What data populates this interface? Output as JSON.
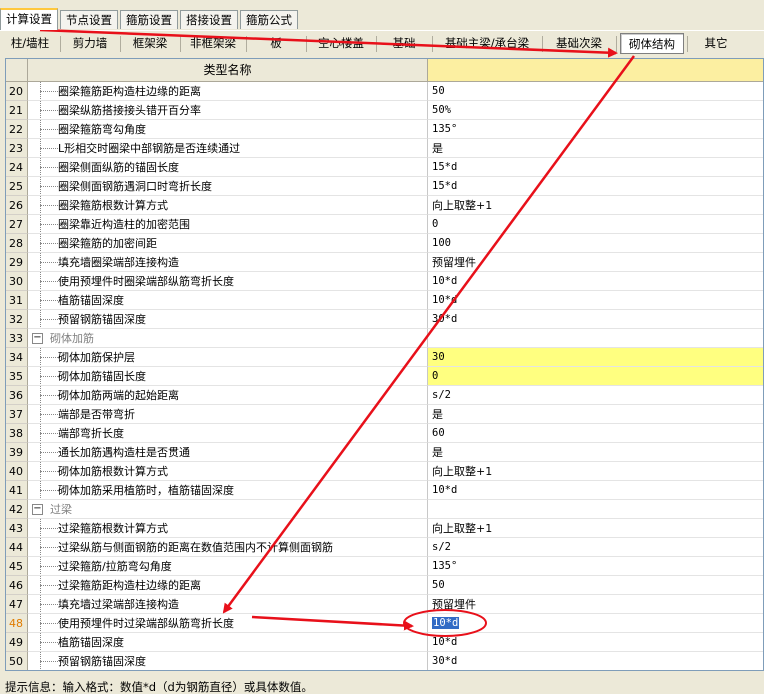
{
  "top_tabs": [
    "计算设置",
    "节点设置",
    "箍筋设置",
    "搭接设置",
    "箍筋公式"
  ],
  "sub_tabs": [
    "柱/墙柱",
    "剪力墙",
    "框架梁",
    "非框架梁",
    "板",
    "空心楼盖",
    "基础",
    "基础主梁/承台梁",
    "基础次梁",
    "砌体结构",
    "其它"
  ],
  "grid": {
    "header_name": "类型名称",
    "rows": [
      {
        "n": "20",
        "name": "圈梁箍筋距构造柱边缘的距离",
        "value": "50"
      },
      {
        "n": "21",
        "name": "圈梁纵筋搭接接头错开百分率",
        "value": "50%"
      },
      {
        "n": "22",
        "name": "圈梁箍筋弯勾角度",
        "value": "135°"
      },
      {
        "n": "23",
        "name": "L形相交时圈梁中部钢筋是否连续通过",
        "value": "是"
      },
      {
        "n": "24",
        "name": "圈梁侧面纵筋的锚固长度",
        "value": "15*d"
      },
      {
        "n": "25",
        "name": "圈梁侧面钢筋遇洞口时弯折长度",
        "value": "15*d"
      },
      {
        "n": "26",
        "name": "圈梁箍筋根数计算方式",
        "value": "向上取整+1"
      },
      {
        "n": "27",
        "name": "圈梁靠近构造柱的加密范围",
        "value": "0"
      },
      {
        "n": "28",
        "name": "圈梁箍筋的加密间距",
        "value": "100"
      },
      {
        "n": "29",
        "name": "填充墙圈梁端部连接构造",
        "value": "预留埋件"
      },
      {
        "n": "30",
        "name": "使用预埋件时圈梁端部纵筋弯折长度",
        "value": "10*d"
      },
      {
        "n": "31",
        "name": "植筋锚固深度",
        "value": "10*d"
      },
      {
        "n": "32",
        "name": "预留钢筋锚固深度",
        "value": "30*d"
      },
      {
        "n": "33",
        "name": "砌体加筋",
        "value": "",
        "group": true,
        "toggle": "−"
      },
      {
        "n": "34",
        "name": "砌体加筋保护层",
        "value": "30",
        "yellow": true
      },
      {
        "n": "35",
        "name": "砌体加筋锚固长度",
        "value": "0",
        "yellow": true
      },
      {
        "n": "36",
        "name": "砌体加筋两端的起始距离",
        "value": "s/2"
      },
      {
        "n": "37",
        "name": "端部是否带弯折",
        "value": "是"
      },
      {
        "n": "38",
        "name": "端部弯折长度",
        "value": "60"
      },
      {
        "n": "39",
        "name": "通长加筋遇构造柱是否贯通",
        "value": "是"
      },
      {
        "n": "40",
        "name": "砌体加筋根数计算方式",
        "value": "向上取整+1"
      },
      {
        "n": "41",
        "name": "砌体加筋采用植筋时，植筋锚固深度",
        "value": "10*d"
      },
      {
        "n": "42",
        "name": "过梁",
        "value": "",
        "group": true,
        "toggle": "−"
      },
      {
        "n": "43",
        "name": "过梁箍筋根数计算方式",
        "value": "向上取整+1"
      },
      {
        "n": "44",
        "name": "过梁纵筋与侧面钢筋的距离在数值范围内不计算侧面钢筋",
        "value": "s/2"
      },
      {
        "n": "45",
        "name": "过梁箍筋/拉筋弯勾角度",
        "value": "135°"
      },
      {
        "n": "46",
        "name": "过梁箍筋距构造柱边缘的距离",
        "value": "50"
      },
      {
        "n": "47",
        "name": "填充墙过梁端部连接构造",
        "value": "预留埋件"
      },
      {
        "n": "48",
        "name": "使用预埋件时过梁端部纵筋弯折长度",
        "value": "10*d",
        "current": true,
        "selected": true
      },
      {
        "n": "49",
        "name": "植筋锚固深度",
        "value": "10*d"
      },
      {
        "n": "50",
        "name": "预留钢筋锚固深度",
        "value": "30*d"
      }
    ]
  },
  "status": "提示信息：输入格式：数值*d（d为钢筋直径）或具体数值。",
  "annotation_color": "#e8101a"
}
